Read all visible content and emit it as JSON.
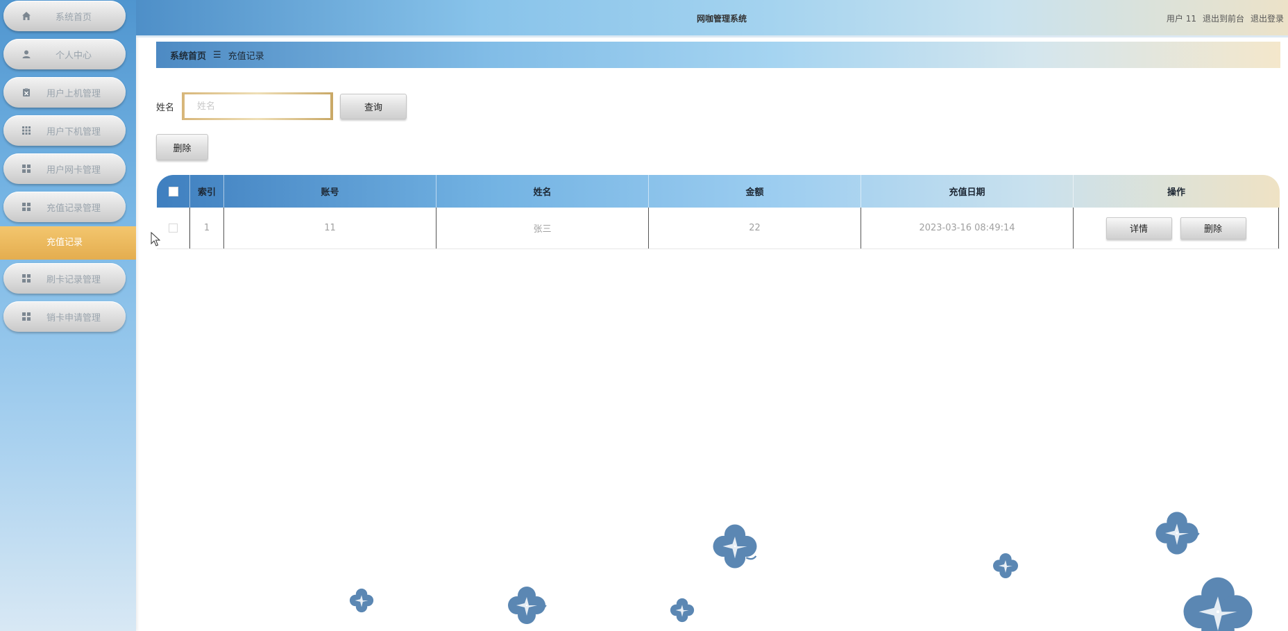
{
  "app": {
    "title": "网咖管理系统"
  },
  "top_links": {
    "user": "用户 11",
    "back_front": "退出到前台",
    "logout": "退出登录"
  },
  "sidebar": {
    "items": [
      {
        "label": "系统首页",
        "icon": "home-icon"
      },
      {
        "label": "个人中心",
        "icon": "user-icon"
      },
      {
        "label": "用户上机管理",
        "icon": "clipboard-icon"
      },
      {
        "label": "用户下机管理",
        "icon": "grid-icon"
      },
      {
        "label": "用户网卡管理",
        "icon": "apps-icon"
      },
      {
        "label": "充值记录管理",
        "icon": "apps-icon"
      },
      {
        "label": "刷卡记录管理",
        "icon": "apps-icon"
      },
      {
        "label": "销卡申请管理",
        "icon": "apps-icon"
      }
    ],
    "active_sub": "充值记录"
  },
  "breadcrumb": {
    "home": "系统首页",
    "separator": "☰",
    "current": "充值记录"
  },
  "search": {
    "label": "姓名",
    "placeholder": "姓名",
    "value": "",
    "button": "查询"
  },
  "actions": {
    "delete": "删除"
  },
  "table": {
    "headers": [
      "索引",
      "账号",
      "姓名",
      "金额",
      "充值日期",
      "操作"
    ],
    "rows": [
      {
        "index": "1",
        "account": "11",
        "name": "张三",
        "amount": "22",
        "date": "2023-03-16 08:49:14",
        "detail_btn": "详情",
        "delete_btn": "删除"
      }
    ]
  },
  "colors": {
    "accent_orange": "#e9b458",
    "clover": "#5b87b3"
  }
}
